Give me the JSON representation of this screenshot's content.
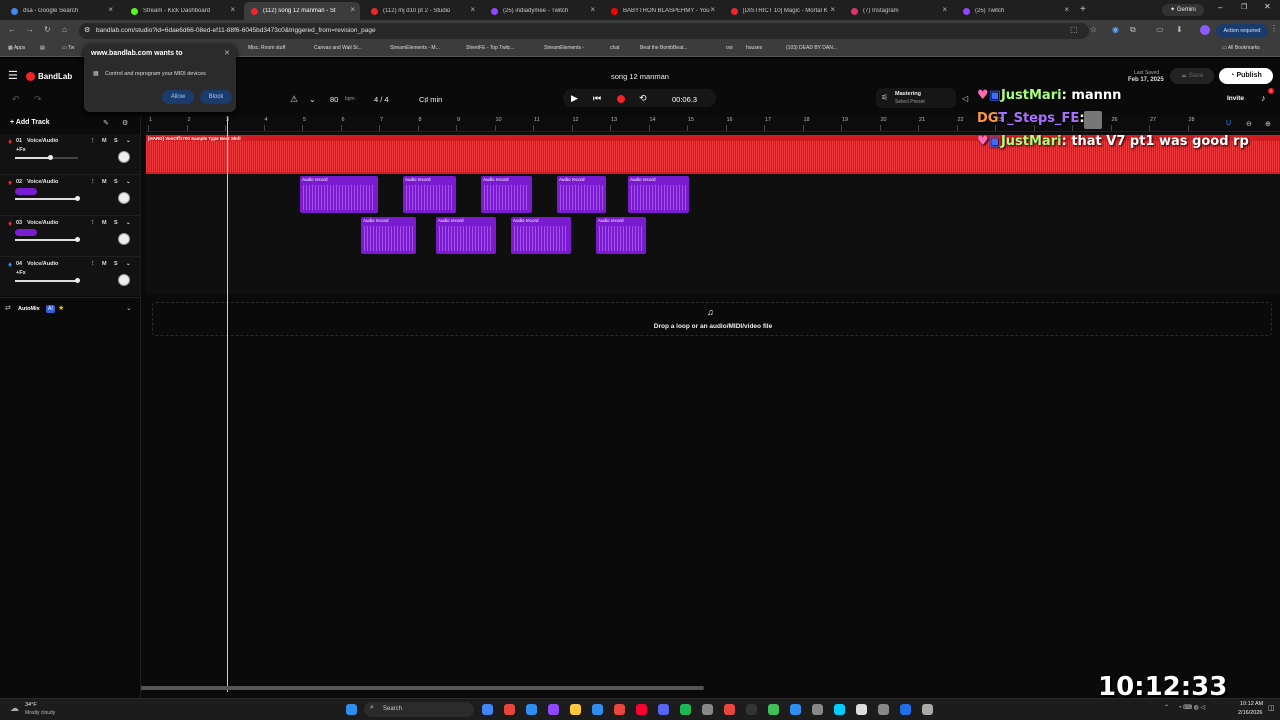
{
  "tabs": [
    {
      "title": "dsa - Google Search",
      "color": "#4285f4"
    },
    {
      "title": "Stream - Kick Dashboard",
      "color": "#53fc18"
    },
    {
      "title": "(112) song 12 manman - St",
      "color": "#f2242a"
    },
    {
      "title": "(112) mj d10 pt 2 - Studio",
      "color": "#f2242a"
    },
    {
      "title": "(25) indiadymee - Twitch",
      "color": "#9146ff"
    },
    {
      "title": "BABYTRON BLASPEHMY - You",
      "color": "#ff0000"
    },
    {
      "title": "[DISTRICT 10] Magic - Mortal K",
      "color": "#f2242a"
    },
    {
      "title": "(7) Instagram",
      "color": "#e1306c"
    },
    {
      "title": "(25) Twitch",
      "color": "#9146ff"
    }
  ],
  "browser": {
    "url": "bandlab.com/studio?id=6dae6d66-08ed-ef11-88f6-6045bd3473c0&triggered_from=revision_page",
    "gemini": "Gemini",
    "action_required": "Action required",
    "apps": "Apps",
    "all_bookmarks": "All Bookmarks",
    "bookmarks": [
      "Misc. Room stuff",
      "Canvas and Wall St...",
      "StreamElements - M...",
      "SheetFE - Top Twitc...",
      "StreamElements -",
      "chat",
      "Beat the BombBeat...",
      "ooi",
      "houses",
      "(103) DEAD BY DAN..."
    ]
  },
  "popup": {
    "title": "www.bandlab.com wants to",
    "message": "Control and reprogram your MIDI devices",
    "allow": "Allow",
    "block": "Block"
  },
  "header": {
    "logo": "BandLab",
    "song_title": "song 12 manman",
    "last_saved_label": "Last Saved",
    "last_saved_date": "Feb 17, 2025",
    "save": "Save",
    "publish": "Publish",
    "invite": "Invite",
    "notification_count": "1"
  },
  "transport": {
    "bpm": "80",
    "bpm_unit": "bpm",
    "time_sig": "4 / 4",
    "key": "C♯ min",
    "time": "00:06.3",
    "mastering": "Mastering",
    "mastering_sub": "Select Preset"
  },
  "sidebar": {
    "add_track": "Add Track",
    "automix": "AutoMix",
    "ai_badge": "AI",
    "tracks": [
      {
        "num": "01",
        "name": "Voice/Audio",
        "fx": "+Fx",
        "volume": 0.55
      },
      {
        "num": "02",
        "name": "Voice/Audio",
        "fx": "",
        "volume": 0.99
      },
      {
        "num": "03",
        "name": "Voice/Audio",
        "fx": "",
        "volume": 0.99
      },
      {
        "num": "04",
        "name": "Voice/Audio",
        "fx": "+Fx",
        "volume": 0.99
      }
    ],
    "mute": "M",
    "solo": "S"
  },
  "ruler": [
    "1",
    "2",
    "3",
    "4",
    "5",
    "6",
    "7",
    "8",
    "9",
    "10",
    "11",
    "12",
    "13",
    "14",
    "15",
    "16",
    "17",
    "18",
    "19",
    "20",
    "21",
    "22",
    "23",
    "24",
    "25",
    "26",
    "27",
    "28"
  ],
  "beat_clip": "[HARD] VonOff1700 Sample Type Beat Skrll",
  "audio_clip_label": "Audio record",
  "drop_zone": "Drop a loop or an audio/MIDI/video file",
  "chat": [
    {
      "user": "JustMari",
      "message": "mannn"
    },
    {
      "user": "T_Steps_FE",
      "message": ""
    },
    {
      "user": "JustMari",
      "message": "that V7 pt1 was good rp"
    }
  ],
  "overlay_clock": "10:12:33 AM",
  "taskbar": {
    "weather_temp": "34°F",
    "weather_desc": "Mostly cloudy",
    "search": "Search",
    "clock_time": "10:12 AM",
    "clock_date": "2/16/2026"
  }
}
